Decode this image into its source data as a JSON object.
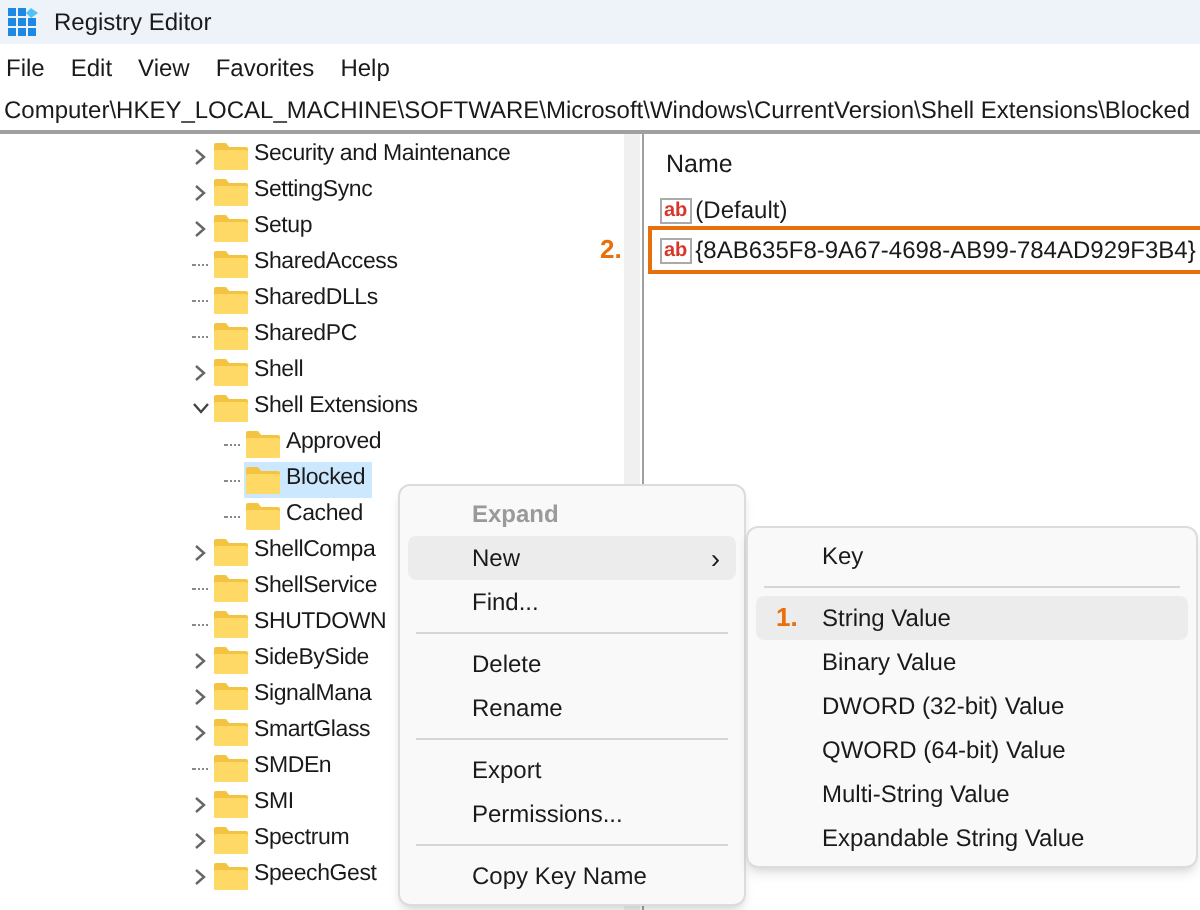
{
  "window": {
    "title": "Registry Editor"
  },
  "menu": [
    "File",
    "Edit",
    "View",
    "Favorites",
    "Help"
  ],
  "address": "Computer\\HKEY_LOCAL_MACHINE\\SOFTWARE\\Microsoft\\Windows\\CurrentVersion\\Shell Extensions\\Blocked",
  "tree": [
    {
      "label": "Security and Maintenance",
      "has_children": true,
      "expanded": false,
      "selected": false
    },
    {
      "label": "SettingSync",
      "has_children": true,
      "expanded": false,
      "selected": false
    },
    {
      "label": "Setup",
      "has_children": true,
      "expanded": false,
      "selected": false
    },
    {
      "label": "SharedAccess",
      "has_children": false,
      "selected": false
    },
    {
      "label": "SharedDLLs",
      "has_children": false,
      "selected": false
    },
    {
      "label": "SharedPC",
      "has_children": false,
      "selected": false
    },
    {
      "label": "Shell",
      "has_children": true,
      "expanded": false,
      "selected": false
    },
    {
      "label": "Shell Extensions",
      "has_children": true,
      "expanded": true,
      "selected": false,
      "children": [
        {
          "label": "Approved",
          "has_children": false,
          "selected": false
        },
        {
          "label": "Blocked",
          "has_children": false,
          "selected": true
        },
        {
          "label": "Cached",
          "has_children": false,
          "selected": false
        }
      ]
    },
    {
      "label": "ShellCompa",
      "has_children": true,
      "expanded": false,
      "selected": false
    },
    {
      "label": "ShellService",
      "has_children": false,
      "selected": false
    },
    {
      "label": "SHUTDOWN",
      "has_children": false,
      "selected": false
    },
    {
      "label": "SideBySide",
      "has_children": true,
      "expanded": false,
      "selected": false
    },
    {
      "label": "SignalMana",
      "has_children": true,
      "expanded": false,
      "selected": false
    },
    {
      "label": "SmartGlass",
      "has_children": true,
      "expanded": false,
      "selected": false
    },
    {
      "label": "SMDEn",
      "has_children": false,
      "selected": false
    },
    {
      "label": "SMI",
      "has_children": true,
      "expanded": false,
      "selected": false
    },
    {
      "label": "Spectrum",
      "has_children": true,
      "expanded": false,
      "selected": false
    },
    {
      "label": "SpeechGest",
      "has_children": true,
      "expanded": false,
      "selected": false
    }
  ],
  "values": {
    "column": "Name",
    "rows": [
      {
        "icon_label": "ab",
        "name": "(Default)",
        "highlighted": false
      },
      {
        "icon_label": "ab",
        "name": "{8AB635F8-9A67-4698-AB99-784AD929F3B4}",
        "highlighted": true,
        "annotation": "2."
      }
    ]
  },
  "context_menu": [
    {
      "kind": "item",
      "label": "Expand",
      "disabled": true,
      "selected": false
    },
    {
      "kind": "item",
      "label": "New",
      "disabled": false,
      "selected": true,
      "submenu": "›"
    },
    {
      "kind": "item",
      "label": "Find...",
      "disabled": false,
      "selected": false
    },
    {
      "kind": "separator"
    },
    {
      "kind": "item",
      "label": "Delete",
      "disabled": false,
      "selected": false
    },
    {
      "kind": "item",
      "label": "Rename",
      "disabled": false,
      "selected": false
    },
    {
      "kind": "separator"
    },
    {
      "kind": "item",
      "label": "Export",
      "disabled": false,
      "selected": false
    },
    {
      "kind": "item",
      "label": "Permissions...",
      "disabled": false,
      "selected": false
    },
    {
      "kind": "separator"
    },
    {
      "kind": "item",
      "label": "Copy Key Name",
      "disabled": false,
      "selected": false
    }
  ],
  "submenu": [
    {
      "kind": "item",
      "label": "Key",
      "disabled": false,
      "selected": false
    },
    {
      "kind": "separator"
    },
    {
      "kind": "item",
      "label": "String Value",
      "disabled": false,
      "selected": true,
      "annotation": "1."
    },
    {
      "kind": "item",
      "label": "Binary Value",
      "disabled": false,
      "selected": false
    },
    {
      "kind": "item",
      "label": "DWORD (32-bit) Value",
      "disabled": false,
      "selected": false
    },
    {
      "kind": "item",
      "label": "QWORD (64-bit) Value",
      "disabled": false,
      "selected": false
    },
    {
      "kind": "item",
      "label": "Multi-String Value",
      "disabled": false,
      "selected": false
    },
    {
      "kind": "item",
      "label": "Expandable String Value",
      "disabled": false,
      "selected": false
    }
  ]
}
